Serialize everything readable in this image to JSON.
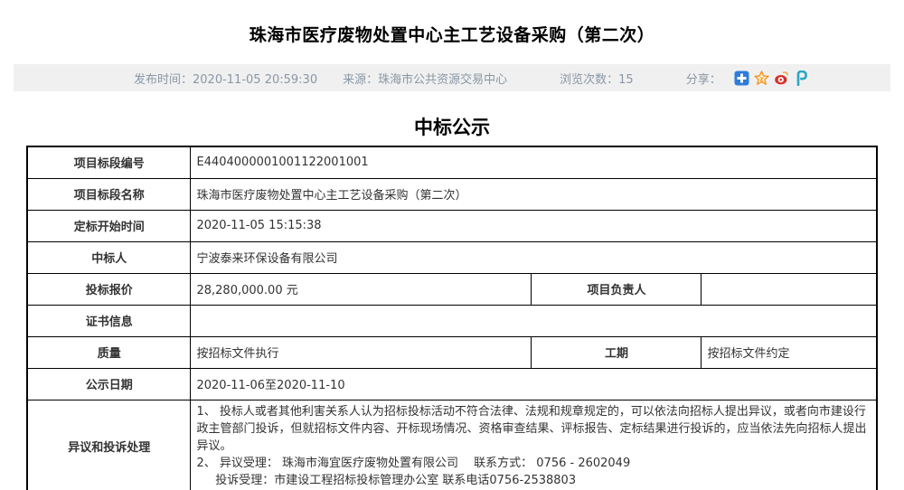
{
  "page": {
    "title": "珠海市医疗废物处置中心主工艺设备采购（第二次）",
    "section_title": "中标公示"
  },
  "meta": {
    "publish_label": "发布时间：",
    "publish_time": "2020-11-05 20:59:30",
    "source_label": "来源：",
    "source": "珠海市公共资源交易中心",
    "views_label": "浏览次数：",
    "views": "15",
    "share_label": "分享："
  },
  "share_icons": [
    {
      "name": "share-more-icon",
      "shape": "blue square with white plus",
      "color": "#2f7bd9"
    },
    {
      "name": "qzone-star-icon",
      "shape": "orange star",
      "color": "#f5941d"
    },
    {
      "name": "weibo-icon",
      "shape": "red weibo eye",
      "color": "#d6302a"
    },
    {
      "name": "pengyou-icon",
      "shape": "teal letter P",
      "color": "#2aa7c0"
    }
  ],
  "colors": {
    "meta_bar_bg": "#f0f0f0",
    "meta_text": "#8a97a5",
    "table_border": "#000000"
  },
  "table": {
    "code": {
      "label": "项目标段编号",
      "value": "E4404000001001122001001"
    },
    "name": {
      "label": "项目标段名称",
      "value": "珠海市医疗废物处置中心主工艺设备采购（第二次）"
    },
    "start_time": {
      "label": "定标开始时间",
      "value": "2020-11-05 15:15:38"
    },
    "winner": {
      "label": "中标人",
      "value": "宁波泰来环保设备有限公司"
    },
    "bid_price": {
      "label": "投标报价",
      "value": "28,280,000.00 元",
      "label2": "项目负责人",
      "value2": ""
    },
    "certificate": {
      "label": "证书信息",
      "value": ""
    },
    "quality": {
      "label": "质量",
      "value": "按招标文件执行",
      "label2": "工期",
      "value2": "按招标文件约定"
    },
    "publicity_date": {
      "label": "公示日期",
      "value": "2020-11-06至2020-11-10"
    },
    "objection": {
      "label": "异议和投诉处理",
      "line1": "1、 投标人或者其他利害关系人认为招标投标活动不符合法律、法规和规章规定的，可以依法向招标人提出异议，或者向市建设行政主管部门投诉，但就招标文件内容、开标现场情况、资格审查结果、评标报告、定标结果进行投诉的，应当依法先向招标人提出异议。",
      "line2": "2、 异议受理： 珠海市海宜医疗废物处置有限公司　 联系方式： 0756 - 2602049",
      "line3": "投诉受理：市建设工程招标投标管理办公室 联系电话0756-2538803"
    }
  }
}
